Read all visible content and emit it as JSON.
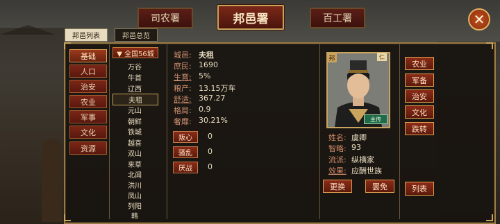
{
  "tabs": [
    {
      "label": "司农署"
    },
    {
      "label": "邦邑署"
    },
    {
      "label": "百工署"
    }
  ],
  "close_symbol": "✕",
  "sub_tabs": {
    "list": "邦邑列表",
    "overview": "邦邑总览"
  },
  "categories": [
    "基础",
    "人口",
    "治安",
    "农业",
    "军事",
    "文化",
    "资源"
  ],
  "city_list": {
    "header": "▼ 全国56城",
    "cities": [
      "万谷",
      "牛首",
      "辽西",
      "夫租",
      "元山",
      "朝鲜",
      "铁城",
      "越喜",
      "双山",
      "来草",
      "北闾",
      "洪川",
      "凤山",
      "列阳",
      "韩"
    ],
    "selected": "夫租"
  },
  "stats": [
    {
      "label": "城邑:",
      "value": "夫租"
    },
    {
      "label": "庶民:",
      "value": "1690"
    },
    {
      "label": "生育:",
      "value": "5%"
    },
    {
      "label": "粮产:",
      "value": "13.15万车"
    },
    {
      "label": "舒适:",
      "value": "367.27"
    },
    {
      "label": "格局:",
      "value": "0.9"
    },
    {
      "label": "奢靡:",
      "value": "30.21%"
    }
  ],
  "events": [
    {
      "label": "叛心",
      "value": "0"
    },
    {
      "label": "骚乱",
      "value": "0"
    },
    {
      "label": "厌战",
      "value": "0"
    }
  ],
  "official": {
    "badge": "邦",
    "corner": "仁",
    "tag": "主传",
    "fields": [
      {
        "label": "姓名:",
        "value": "虞卿"
      },
      {
        "label": "智略:",
        "value": "93"
      },
      {
        "label": "流派:",
        "value": "纵横家"
      },
      {
        "label": "效果:",
        "value": "应酬世族"
      }
    ],
    "replace_label": "更换",
    "dismiss_label": "罢免"
  },
  "departments": [
    "农业",
    "军备",
    "治安",
    "文化",
    "跌转"
  ],
  "list_label": "列表"
}
